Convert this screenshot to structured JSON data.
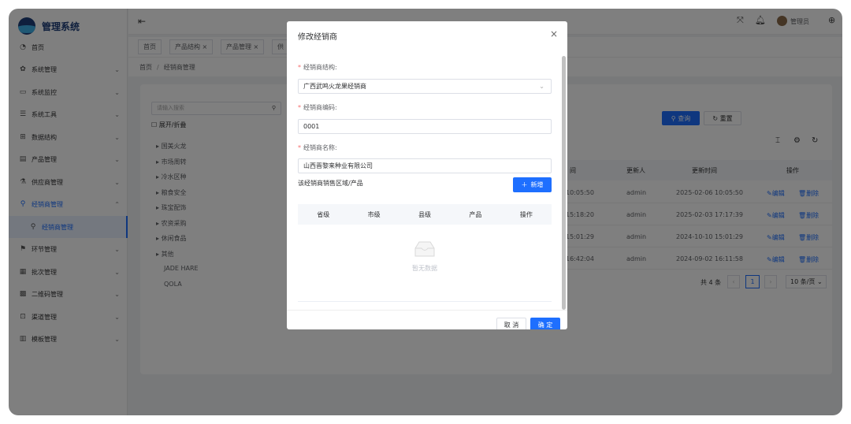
{
  "app": {
    "title": "管理系统",
    "user": "管理员"
  },
  "sidebar": {
    "items": [
      {
        "label": "首页",
        "icon": "◔",
        "chev": ""
      },
      {
        "label": "系统管理",
        "icon": "✿",
        "chev": "⌄"
      },
      {
        "label": "系统监控",
        "icon": "▭",
        "chev": "⌄"
      },
      {
        "label": "系统工具",
        "icon": "☰",
        "chev": "⌄"
      },
      {
        "label": "数据结构",
        "icon": "⊞",
        "chev": "⌄"
      },
      {
        "label": "产品管理",
        "icon": "▤",
        "chev": "⌄"
      },
      {
        "label": "供应商管理",
        "icon": "⚗",
        "chev": "⌄"
      },
      {
        "label": "经销商管理",
        "icon": "⚲",
        "chev": "⌃"
      },
      {
        "label": "经销商管理",
        "icon": "⚲",
        "chev": ""
      },
      {
        "label": "环节管理",
        "icon": "⚑",
        "chev": "⌄"
      },
      {
        "label": "批次管理",
        "icon": "▦",
        "chev": "⌄"
      },
      {
        "label": "二维码管理",
        "icon": "▩",
        "chev": "⌄"
      },
      {
        "label": "渠道管理",
        "icon": "⊡",
        "chev": "⌄"
      },
      {
        "label": "模板管理",
        "icon": "▥",
        "chev": "⌄"
      }
    ]
  },
  "tabs": [
    "首页",
    "产品结构",
    "产品管理",
    "供"
  ],
  "breadcrumb": {
    "home": "首页",
    "sep": "/",
    "current": "经销商管理"
  },
  "background": {
    "search_placeholder": "请输入搜索",
    "tree_toggle": "展开/折叠",
    "tree_items": [
      "国美火龙",
      "市场周转",
      "冷水区种",
      "粮食安全",
      "珠宝配饰",
      "农资采购",
      "休闲食品",
      "其他",
      "JADE HARE",
      "QOLA"
    ],
    "query_btn": "查询",
    "reset_btn": "重置",
    "col_update_user": "更新人",
    "col_update_time": "更新时间",
    "col_actions": "操作",
    "col_time_partial": "间",
    "rows": [
      {
        "t1": "10:05:50",
        "user": "admin",
        "time": "2025-02-06 10:05:50"
      },
      {
        "t1": "15:18:20",
        "user": "admin",
        "time": "2025-02-03 17:17:39"
      },
      {
        "t1": "15:01:29",
        "user": "admin",
        "time": "2024-10-10 15:01:29"
      },
      {
        "t1": "16:42:04",
        "user": "admin",
        "time": "2024-09-02 16:11:58"
      }
    ],
    "edit": "编辑",
    "delete": "删除",
    "pager": {
      "total": "共 4 条",
      "page": "1",
      "size": "10 条/页"
    }
  },
  "modal": {
    "title": "修改经销商",
    "field1_label": "经销商结构:",
    "field1_value": "广西武鸣火龙果经销商",
    "field2_label": "经销商编码:",
    "field2_value": "0001",
    "field3_label": "经销商名称:",
    "field3_value": "山西晋黎来种业有限公司",
    "region_title": "该经销商销售区域/产品",
    "add_btn": "新增",
    "columns": [
      "省级",
      "市级",
      "县级",
      "产品",
      "操作"
    ],
    "empty_text": "暂无数据",
    "cancel": "取 消",
    "confirm": "确 定"
  },
  "colors": {
    "primary": "#1e6fff",
    "danger": "#f56c6c"
  }
}
